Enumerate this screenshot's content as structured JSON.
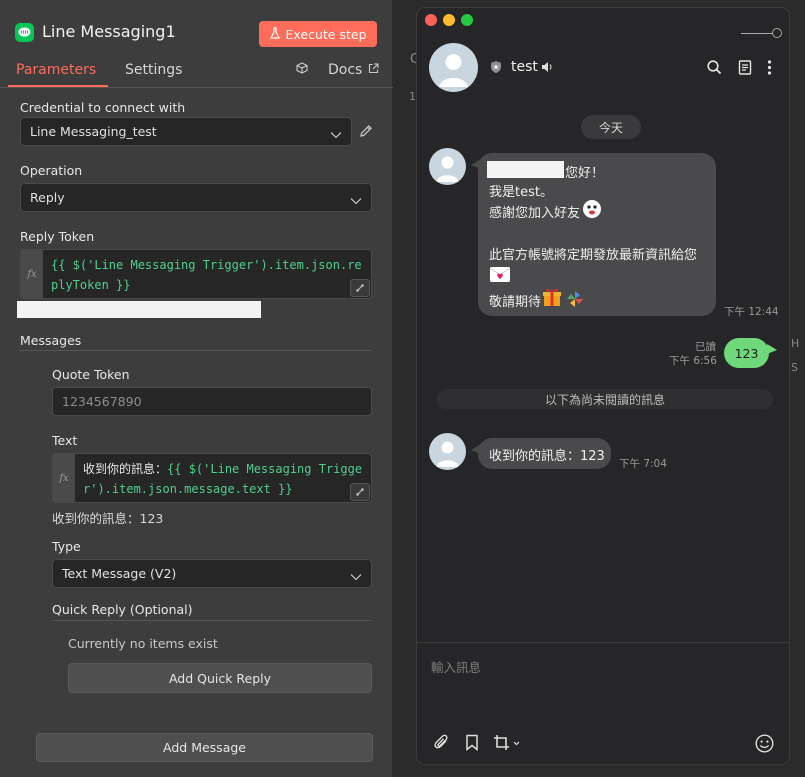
{
  "node_panel": {
    "title": "Line Messaging1",
    "execute_label": "Execute step",
    "tabs": [
      {
        "label": "Parameters",
        "active": true
      },
      {
        "label": "Settings",
        "active": false
      }
    ],
    "docs_label": "Docs",
    "credential": {
      "label": "Credential to connect with",
      "value": "Line Messaging_test"
    },
    "operation": {
      "label": "Operation",
      "value": "Reply"
    },
    "reply_token": {
      "label": "Reply Token",
      "expression": "{{ $('Line Messaging Trigger').item.json.replyToken }}"
    },
    "messages": {
      "label": "Messages",
      "quote_token": {
        "label": "Quote Token",
        "placeholder": "1234567890"
      },
      "text": {
        "label": "Text",
        "prefix": "收到你的訊息：",
        "expression": "{{ $('Line Messaging Trigger').item.json.message.text }}",
        "result": "收到你的訊息：123"
      },
      "type": {
        "label": "Type",
        "value": "Text Message (V2)"
      },
      "quick_reply": {
        "label": "Quick Reply (Optional)",
        "empty_text": "Currently no items exist",
        "add_label": "Add Quick Reply"
      }
    },
    "add_message_label": "Add Message"
  },
  "line_window": {
    "chat_name": "test",
    "date_label": "今天",
    "incoming_welcome": {
      "lines": [
        "您好！",
        "我是test。",
        "感謝您加入好友",
        "此官方帳號將定期發放最新資訊給您",
        "敬請期待"
      ],
      "time": "下午 12:44"
    },
    "outgoing": {
      "text": "123",
      "read_label": "已讀",
      "time": "下午 6:56"
    },
    "unread_divider": "以下為尚未閱讀的訊息",
    "incoming_reply": {
      "text": "收到你的訊息：123",
      "time": "下午 7:04"
    },
    "compose_placeholder": "輸入訊息"
  },
  "background_fragments": [
    "C",
    "1",
    "H",
    "S"
  ],
  "colors": {
    "accent": "#ff6d5a",
    "line_green": "#06c755",
    "expression_green": "#4fd08e",
    "outgoing_bubble": "#6ed87a",
    "panel_bg": "#3d3d3d",
    "chat_bg": "#262628"
  }
}
